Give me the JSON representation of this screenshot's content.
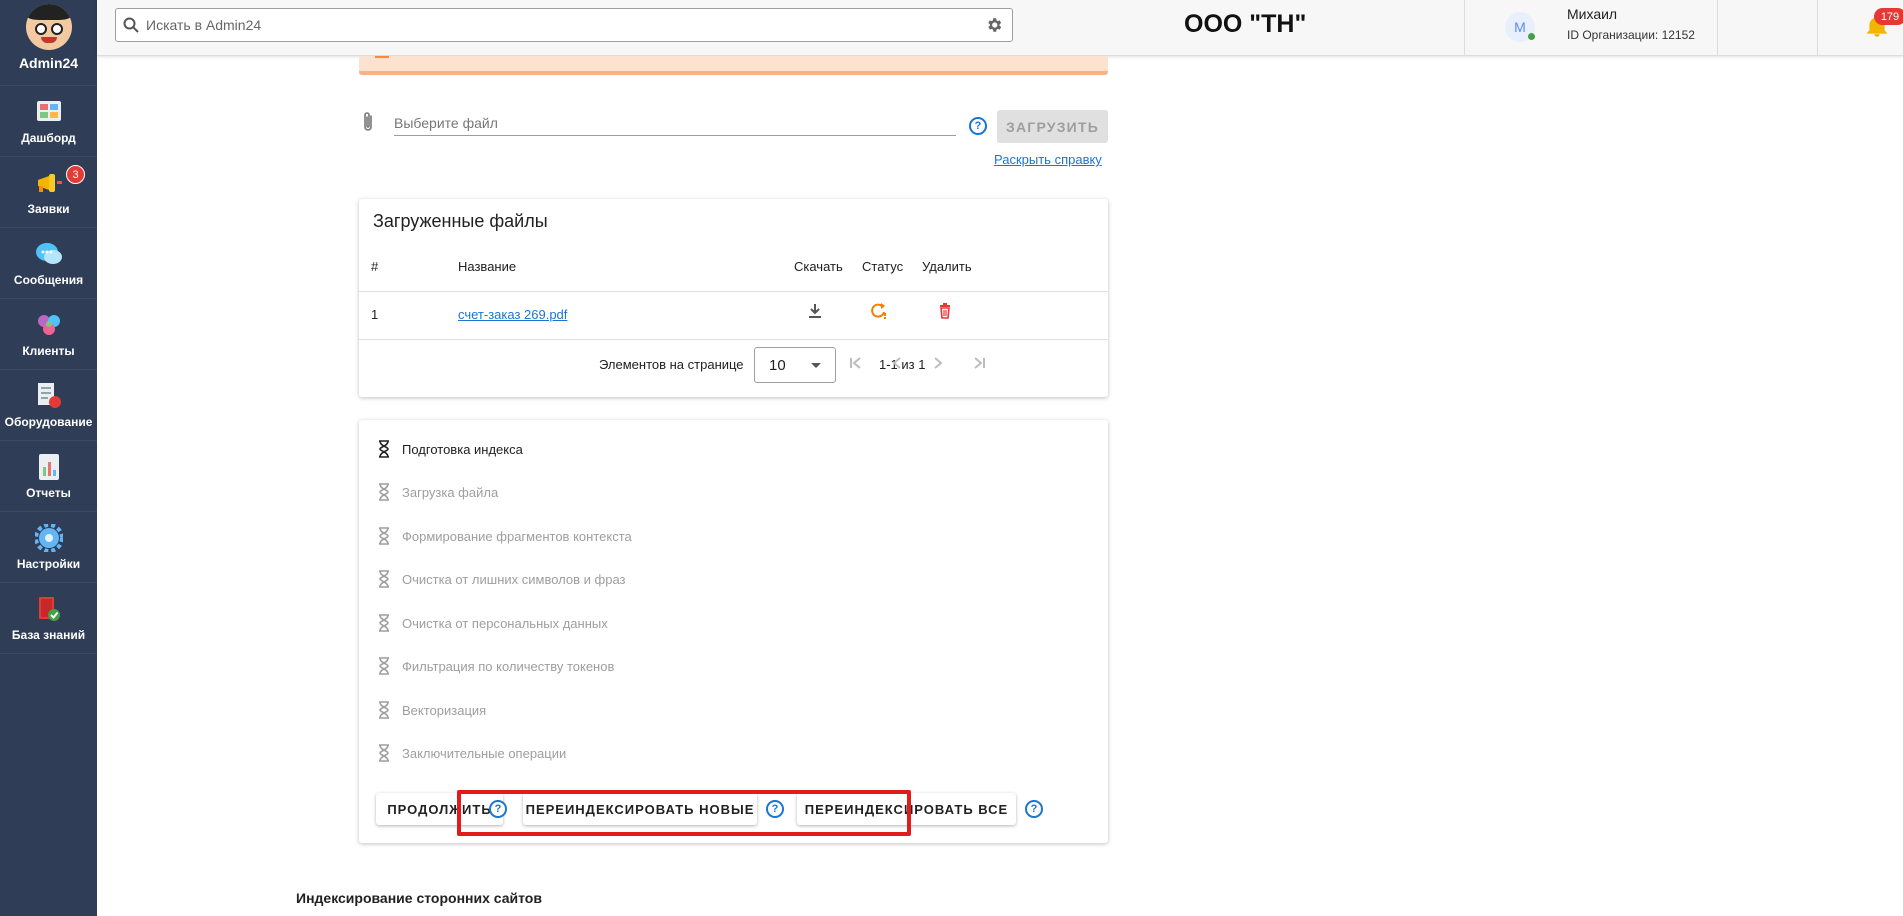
{
  "brand": {
    "name": "Admin24"
  },
  "sidebar": {
    "items": [
      {
        "label": "Дашборд",
        "icon": "dashboard-icon",
        "color": "#e57373"
      },
      {
        "label": "Заявки",
        "icon": "megaphone-icon",
        "color": "#f4b400",
        "badge": "3"
      },
      {
        "label": "Сообщения",
        "icon": "chat-icon",
        "color": "#4fc3f7"
      },
      {
        "label": "Клиенты",
        "icon": "clients-icon",
        "color": "#ba68c8"
      },
      {
        "label": "Оборудование",
        "icon": "equipment-icon",
        "color": "#e0e0e0"
      },
      {
        "label": "Отчеты",
        "icon": "reports-icon",
        "color": "#81c784"
      },
      {
        "label": "Настройки",
        "icon": "settings-icon",
        "color": "#64b5f6"
      },
      {
        "label": "База знаний",
        "icon": "knowledge-base-icon",
        "color": "#e53935"
      }
    ]
  },
  "topbar": {
    "search_placeholder": "Искать в Admin24",
    "org_title": "ООО \"ТН\"",
    "user": {
      "initial": "М",
      "name": "Михаил",
      "org_id": "ID Организации: 12152"
    },
    "notifications_count": "179",
    "help": "?"
  },
  "upload": {
    "placeholder": "Выберите файл",
    "button_label": "ЗАГРУЗИТЬ",
    "help_link": "Раскрыть справку"
  },
  "files": {
    "title": "Загруженные файлы",
    "columns": [
      "#",
      "Название",
      "Скачать",
      "Статус",
      "Удалить"
    ],
    "rows": [
      {
        "num": "1",
        "name": "счет-заказ 269.pdf"
      }
    ],
    "pager": {
      "label": "Элементов на странице",
      "page_size": "10",
      "range": "1-1 из 1"
    }
  },
  "steps": {
    "items": [
      {
        "label": "Подготовка индекса",
        "active": true
      },
      {
        "label": "Загрузка файла",
        "active": false
      },
      {
        "label": "Формирование фрагментов контекста",
        "active": false
      },
      {
        "label": "Очистка от лишних символов и фраз",
        "active": false
      },
      {
        "label": "Очистка от персональных данных",
        "active": false
      },
      {
        "label": "Фильтрация по количеству токенов",
        "active": false
      },
      {
        "label": "Векторизация",
        "active": false
      },
      {
        "label": "Заключительные операции",
        "active": false
      }
    ],
    "buttons": {
      "continue": "ПРОДОЛЖИТЬ",
      "reindex_new": "ПЕРЕИНДЕКСИРОВАТЬ НОВЫЕ",
      "reindex_all": "ПЕРЕИНДЕКСИРОВАТЬ ВСЕ"
    }
  },
  "external_sites": {
    "title": "Индексирование сторонних сайтов"
  },
  "colors": {
    "sidebar_bg": "#2f3e56",
    "accent": "#1976d2",
    "highlight": "#e21b1b",
    "status": "#f57c00",
    "delete": "#e53935"
  }
}
